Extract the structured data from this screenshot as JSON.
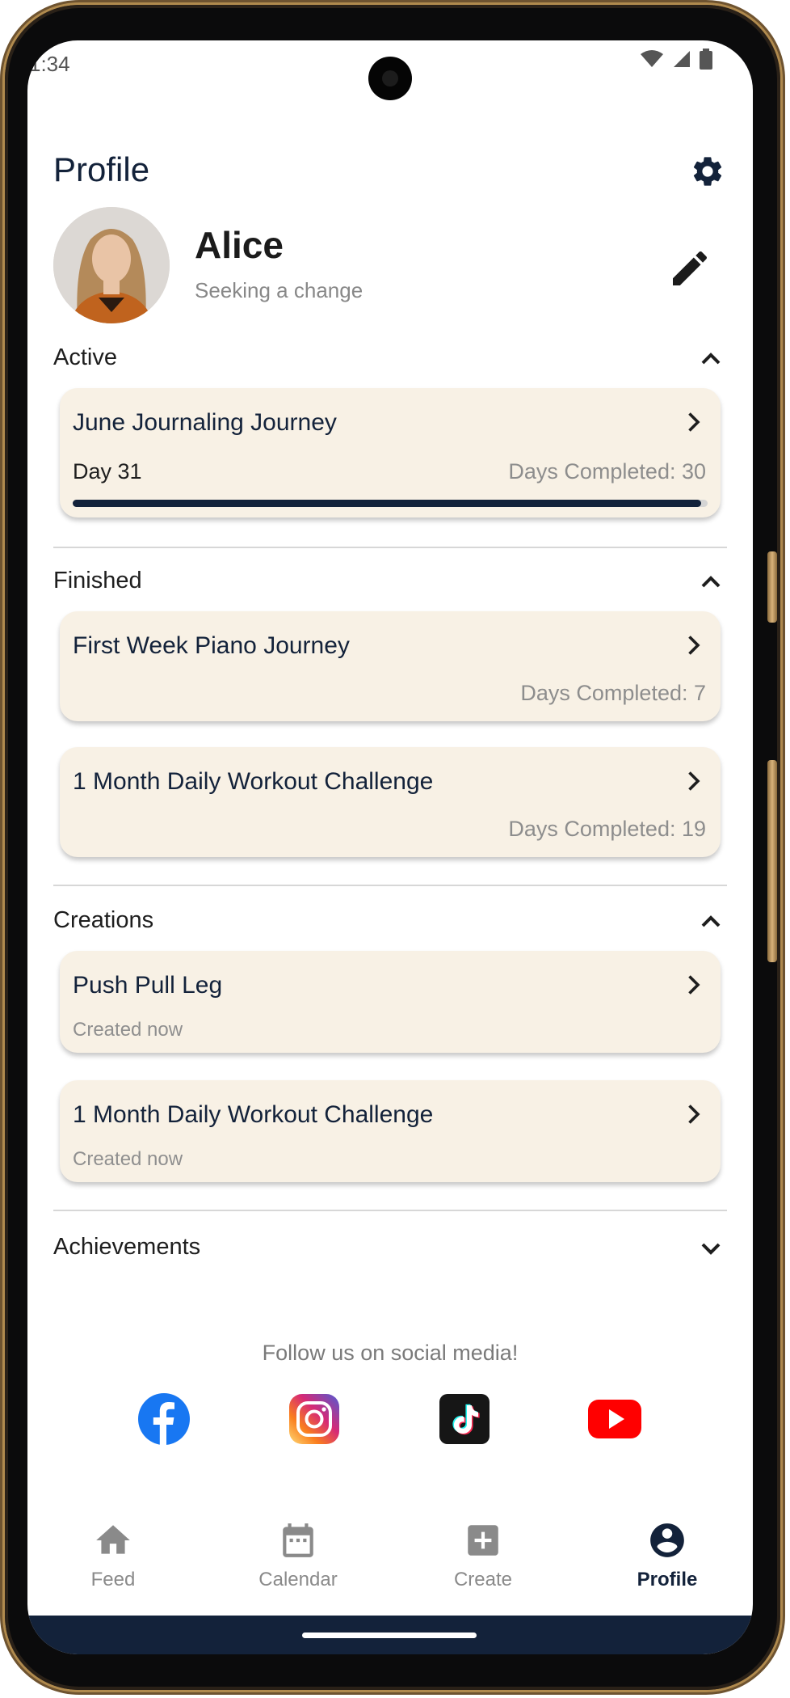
{
  "status_bar": {
    "time": "1:34"
  },
  "header": {
    "title": "Profile"
  },
  "profile": {
    "name": "Alice",
    "tagline": "Seeking a change"
  },
  "sections": {
    "active": {
      "title": "Active",
      "cards": [
        {
          "title": "June Journaling Journey",
          "day_label": "Day 31",
          "completed": "Days Completed: 30",
          "progress": 0.99
        }
      ]
    },
    "finished": {
      "title": "Finished",
      "cards": [
        {
          "title": "First Week Piano Journey",
          "completed": "Days Completed: 7"
        },
        {
          "title": "1 Month Daily Workout Challenge",
          "completed": "Days Completed: 19"
        }
      ]
    },
    "creations": {
      "title": "Creations",
      "cards": [
        {
          "title": "Push Pull Leg",
          "subtitle": "Created now"
        },
        {
          "title": "1 Month Daily Workout Challenge",
          "subtitle": "Created now"
        }
      ]
    },
    "achievements": {
      "title": "Achievements"
    }
  },
  "social": {
    "heading": "Follow us on social media!",
    "icons": [
      "facebook-icon",
      "instagram-icon",
      "tiktok-icon",
      "youtube-icon"
    ]
  },
  "nav": {
    "items": [
      {
        "label": "Feed",
        "icon": "home-icon"
      },
      {
        "label": "Calendar",
        "icon": "calendar-icon"
      },
      {
        "label": "Create",
        "icon": "add-box-icon"
      },
      {
        "label": "Profile",
        "icon": "account-circle-icon",
        "active": true
      }
    ]
  },
  "colors": {
    "primary": "#13223a",
    "card_bg": "#f8f1e5",
    "muted": "#8a8a8a"
  }
}
